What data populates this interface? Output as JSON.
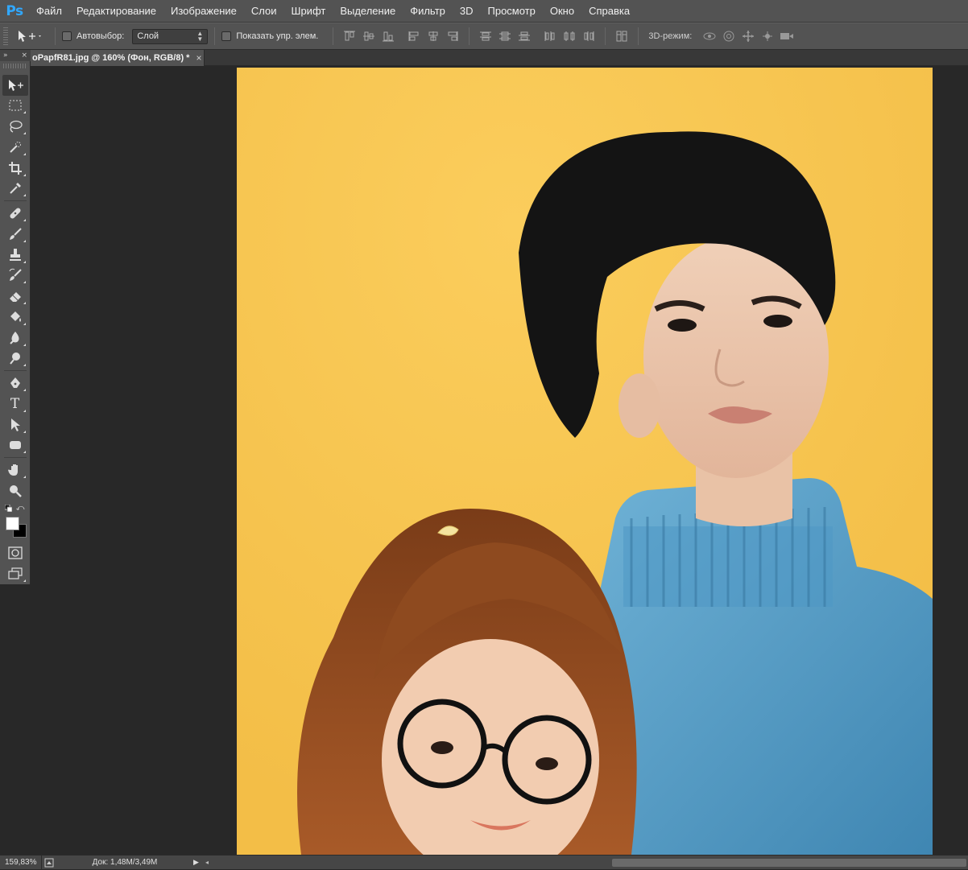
{
  "app": {
    "logo": "Ps",
    "menu": [
      "Файл",
      "Редактирование",
      "Изображение",
      "Слои",
      "Шрифт",
      "Выделение",
      "Фильтр",
      "3D",
      "Просмотр",
      "Окно",
      "Справка"
    ]
  },
  "options": {
    "auto_select_label": "Автовыбор:",
    "auto_select_value": "Слой",
    "show_controls_label": "Показать упр. элем.",
    "mode3d_label": "3D-режим:"
  },
  "document": {
    "tab_title": "oPapfR81.jpg @ 160% (Фон, RGB/8) *",
    "close_glyph": "×"
  },
  "panel": {
    "collapse_glyph": "»",
    "close_glyph": "×"
  },
  "toolbox": {
    "tools": [
      "move-tool-icon",
      "marquee-tool-icon",
      "lasso-tool-icon",
      "quick-selection-tool-icon",
      "crop-tool-icon",
      "eyedropper-tool-icon",
      "healing-brush-tool-icon",
      "brush-tool-icon",
      "clone-stamp-tool-icon",
      "history-brush-tool-icon",
      "eraser-tool-icon",
      "paint-bucket-tool-icon",
      "blur-tool-icon",
      "dodge-tool-icon",
      "pen-tool-icon",
      "type-tool-icon",
      "path-selection-tool-icon",
      "shape-tool-icon",
      "hand-tool-icon",
      "zoom-tool-icon"
    ],
    "type_glyph": "T",
    "foreground_color": "#ffffff",
    "background_color": "#000000"
  },
  "colors": {
    "canvas_background": "#f7c550",
    "workspace": "#282828",
    "panel": "#535353",
    "accent": "#31a8ff"
  },
  "status": {
    "zoom": "159,83%",
    "doc_size": "Док: 1,48M/3,49M",
    "play_glyph": "▶",
    "scroll_left_glyph": "◂"
  }
}
